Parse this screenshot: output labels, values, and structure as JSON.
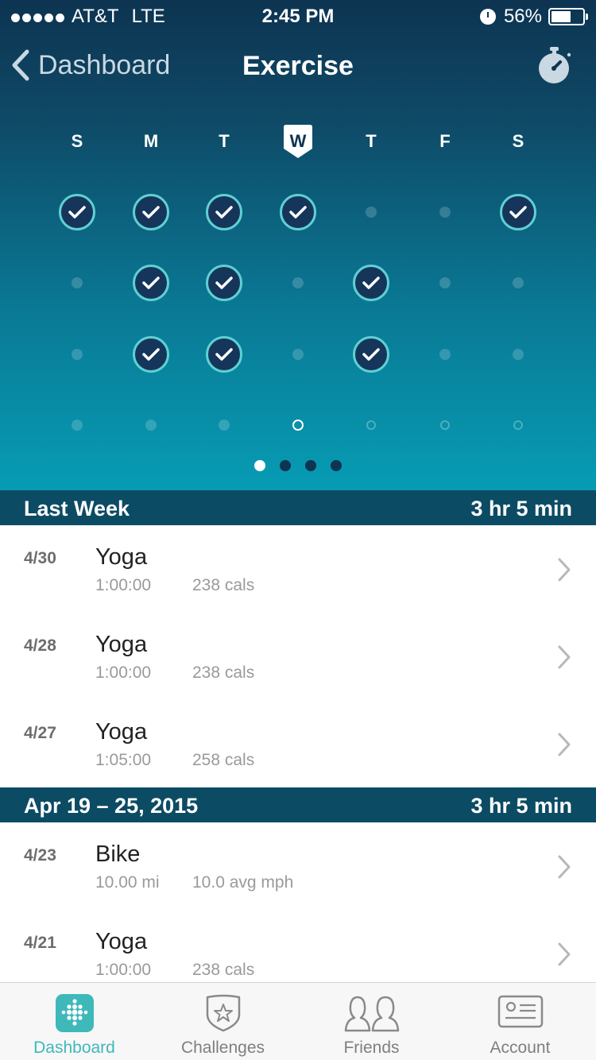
{
  "status_bar": {
    "carrier": "AT&T",
    "network": "LTE",
    "time": "2:45 PM",
    "battery": "56%",
    "battery_level": 0.56,
    "signal_bars": 5
  },
  "nav": {
    "back_label": "Dashboard",
    "title": "Exercise",
    "right_icon": "stopwatch-icon"
  },
  "week": {
    "days": [
      "S",
      "M",
      "T",
      "W",
      "T",
      "F",
      "S"
    ],
    "today_index": 3,
    "goal_rows": [
      [
        "check",
        "check",
        "check",
        "check",
        "dot",
        "dot",
        "check"
      ],
      [
        "dot",
        "check",
        "check",
        "dot",
        "check",
        "dot",
        "dot"
      ],
      [
        "dot",
        "check",
        "check",
        "dot",
        "check",
        "dot",
        "dot"
      ],
      [
        "dot",
        "dot",
        "dot",
        "today",
        "future",
        "future",
        "future"
      ]
    ],
    "page_count": 4,
    "active_page": 0
  },
  "sections": [
    {
      "label": "Last Week",
      "total": "3 hr 5 min",
      "items": [
        {
          "date": "4/30",
          "name": "Yoga",
          "m1": "1:00:00",
          "m2": "238 cals"
        },
        {
          "date": "4/28",
          "name": "Yoga",
          "m1": "1:00:00",
          "m2": "238 cals"
        },
        {
          "date": "4/27",
          "name": "Yoga",
          "m1": "1:05:00",
          "m2": "258 cals"
        }
      ]
    },
    {
      "label": "Apr 19 – 25, 2015",
      "total": "3 hr 5 min",
      "items": [
        {
          "date": "4/23",
          "name": "Bike",
          "m1": "10.00 mi",
          "m2": "10.0 avg mph"
        },
        {
          "date": "4/21",
          "name": "Yoga",
          "m1": "1:00:00",
          "m2": "238 cals"
        }
      ]
    }
  ],
  "tabs": [
    {
      "label": "Dashboard",
      "icon": "dashboard-icon",
      "active": true
    },
    {
      "label": "Challenges",
      "icon": "challenges-icon",
      "active": false
    },
    {
      "label": "Friends",
      "icon": "friends-icon",
      "active": false
    },
    {
      "label": "Account",
      "icon": "account-icon",
      "active": false
    }
  ],
  "colors": {
    "header_dark": "#0d3451",
    "header_teal": "#079cb4",
    "check_ring": "#5fd0d3",
    "section_bar": "#0c4b64",
    "accent": "#3fb8ba"
  }
}
